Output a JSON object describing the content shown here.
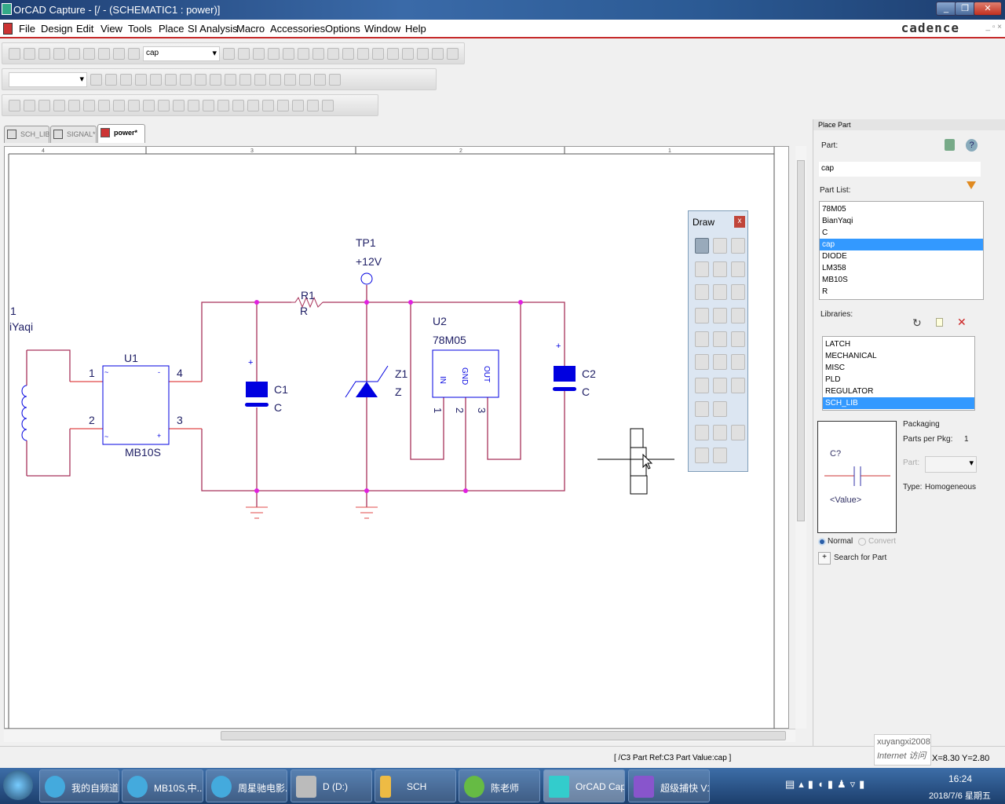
{
  "window": {
    "title": "OrCAD Capture - [/ - (SCHEMATIC1 : power)]",
    "min": "_",
    "restore": "❐",
    "close": "✕"
  },
  "menu": [
    "File",
    "Design",
    "Edit",
    "View",
    "Tools",
    "Place",
    "SI Analysis",
    "Macro",
    "Accessories",
    "Options",
    "Window",
    "Help"
  ],
  "brand": "cadence",
  "toolbar1": {
    "zoom_combo": "cap",
    "icons_left": [
      "new-icon",
      "open-icon",
      "save-icon",
      "print-icon",
      "cut-icon",
      "copy-icon",
      "paste-icon",
      "undo-icon",
      "redo-icon"
    ],
    "icons_right": [
      "zoom-in-icon",
      "zoom-out-icon",
      "zoom-area-icon",
      "zoom-all-icon",
      "eye-icon",
      "annotate-icon",
      "back-annotate-icon",
      "drc-icon",
      "netlist-icon",
      "cross-ref-icon",
      "bom-icon",
      "snap-icon",
      "project-manager-icon",
      "part-icon",
      "hierarchy-icon",
      "help-icon"
    ]
  },
  "toolbar2": {
    "combo1": "",
    "combo2": "",
    "icons": [
      "find-icon",
      "prev-icon",
      "next-icon",
      "probe-icon",
      "marker-icon",
      "sim-icon",
      "voltage-icon",
      "current-icon",
      "power-icon",
      "diff-icon",
      "bias-v-icon",
      "bias-i-icon",
      "bias-w-icon",
      "v-icon",
      "i-icon",
      "w-icon",
      "p-icon"
    ]
  },
  "toolbar3": {
    "icons": [
      "align-left-icon",
      "align-center-icon",
      "align-right-icon",
      "align-top-icon",
      "align-middle-icon",
      "align-bottom-icon",
      "distribute-h-icon",
      "distribute-v-icon",
      "grid-icon",
      "filter-icon",
      "property-icon",
      "edit-icon",
      "page-icon",
      "table-icon",
      "pin-icon",
      "ladder-icon",
      "hdl-icon",
      "vertical-icon",
      "horizontal-icon",
      "spread-icon",
      "center-icon",
      "tag-icon"
    ]
  },
  "tabs": [
    {
      "label": "SCH_LIB"
    },
    {
      "label": "SIGNAL*"
    },
    {
      "label": "power*"
    }
  ],
  "ruler": [
    "4",
    "3",
    "2",
    "1"
  ],
  "schematic": {
    "t1": {
      "ref": "1",
      "value": "iYaqi"
    },
    "u1": {
      "ref": "U1",
      "value": "MB10S",
      "pins": [
        "1",
        "2",
        "4",
        "3"
      ]
    },
    "r1": {
      "ref": "R1",
      "value": "R"
    },
    "tp1": {
      "ref": "TP1",
      "value": "+12V"
    },
    "c1": {
      "ref": "C1",
      "value": "C",
      "plus": "+"
    },
    "z1": {
      "ref": "Z1",
      "value": "Z"
    },
    "u2": {
      "ref": "U2",
      "value": "78M05",
      "pin_names": [
        "IN",
        "GND",
        "OUT"
      ],
      "pins": [
        "1",
        "2",
        "3"
      ]
    },
    "c2": {
      "ref": "C2",
      "value": "C",
      "plus": "+"
    },
    "colors": {
      "wire": "#a8325a",
      "pin": "#e04848",
      "junction": "#e020e0",
      "part": "#0000e0",
      "label": "#202066"
    }
  },
  "draw_palette": {
    "title": "Draw",
    "close": "x",
    "tools": [
      "select-icon",
      "place-part-icon",
      "wire-icon",
      "auto-wire-icon",
      "auto-wire-2-icon",
      "auto-wire-multi-icon",
      "bus-icon",
      "net-alias-icon",
      "bus-entry-icon",
      "junction-icon",
      "no-connect-icon",
      "power-icon",
      "ground-icon",
      "hier-block-icon",
      "hier-port-icon",
      "hier-pin-icon",
      "off-page-icon",
      "no-erc-icon",
      "line-icon",
      "polyline-icon",
      "rectangle-icon",
      "ellipse-icon",
      "arc-icon",
      "",
      "elliptical-arc-icon",
      "bezier-icon",
      "text-icon",
      "picture-icon",
      "ieee-icon"
    ]
  },
  "panel": {
    "title": "Place Part",
    "part_label": "Part:",
    "part_value": "cap",
    "part_list_label": "Part List:",
    "parts": [
      "78M05",
      "BianYaqi",
      "C",
      "cap",
      "DIODE",
      "LM358",
      "MB10S",
      "R"
    ],
    "selected_part": "cap",
    "libraries_label": "Libraries:",
    "libraries": [
      "LATCH",
      "MECHANICAL",
      "MISC",
      "PLD",
      "REGULATOR",
      "SCH_LIB"
    ],
    "selected_library": "SCH_LIB",
    "preview": {
      "ref": "C?",
      "value": "<Value>"
    },
    "packaging": {
      "title": "Packaging",
      "parts_per_pkg_label": "Parts per Pkg:",
      "parts_per_pkg": "1",
      "part_label": "Part:",
      "type_label": "Type:",
      "type": "Homogeneous"
    },
    "normal": "Normal",
    "convert": "Convert",
    "search_btn": "+",
    "search": "Search for Part"
  },
  "status": {
    "message": "[ /C3 Part Ref:C3 Part Value:cap ]",
    "coords": "X=8.30  Y=2.80",
    "tooltip_user": "xuyangxi2008",
    "tooltip_sub": "Internet 访问"
  },
  "taskbar": {
    "items": [
      "我的自频道-...",
      "MB10S,中...",
      "周星驰电影...",
      "D (D:)",
      "SCH",
      "陈老师",
      "OrCAD Cap...",
      "超级捕快 V1..."
    ],
    "time": "16:24",
    "date": "2018/7/6 星期五"
  }
}
